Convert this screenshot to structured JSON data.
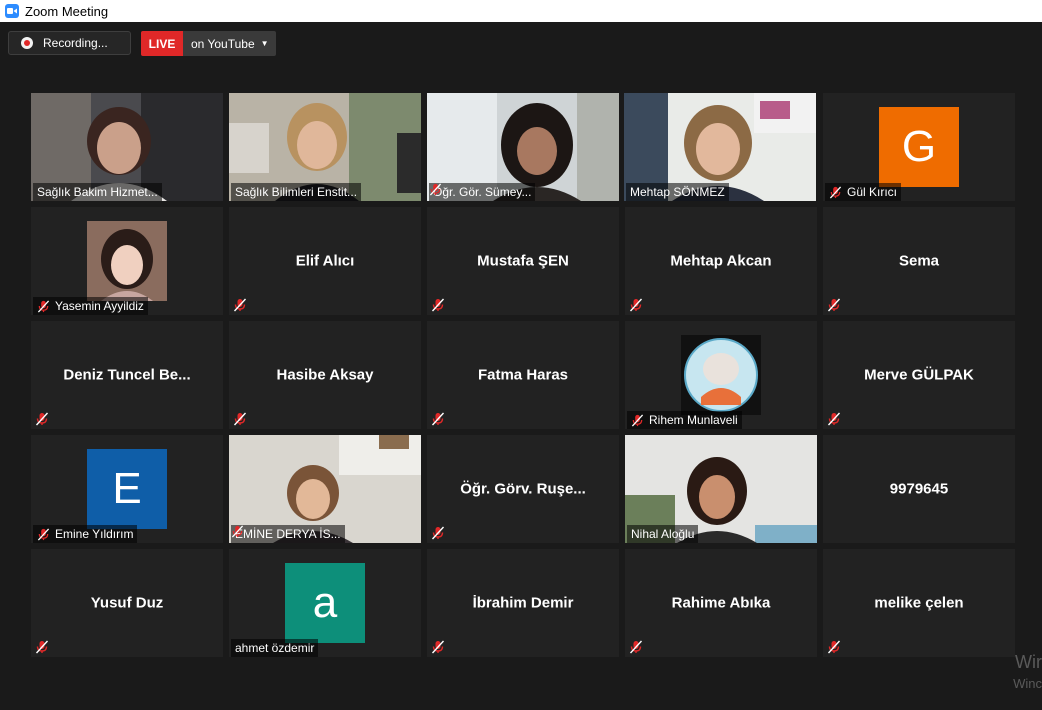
{
  "window": {
    "title": "Zoom Meeting"
  },
  "toolbar": {
    "recording_label": "Recording...",
    "live_badge": "LIVE",
    "live_target": "on YouTube"
  },
  "colors": {
    "active_speaker_border": "#dde64a",
    "live_red": "#e02828",
    "avatar_orange": "#ef6c00",
    "avatar_blue": "#0f5ea8",
    "avatar_teal": "#0d8f7a"
  },
  "participants": [
    {
      "name": "Sağlık Bakim Hizmet...",
      "video": true,
      "muted": false
    },
    {
      "name": "Sağlık Bilimleri Enstit...",
      "video": true,
      "muted": false
    },
    {
      "name": "Öğr. Gör. Sümey...",
      "video": true,
      "muted": true
    },
    {
      "name": "Mehtap SÖNMEZ",
      "video": true,
      "muted": false,
      "active_speaker": true
    },
    {
      "name": "Gül Kırıcı",
      "avatar_letter": "G",
      "muted": true
    },
    {
      "name": "Yasemin Ayyildiz",
      "avatar_photo": true,
      "muted": true
    },
    {
      "name": "Elif Alıcı",
      "muted": true
    },
    {
      "name": "Mustafa ŞEN",
      "muted": true
    },
    {
      "name": "Mehtap Akcan",
      "muted": true
    },
    {
      "name": "Sema",
      "muted": true
    },
    {
      "name": "Deniz Tuncel Be...",
      "muted": true
    },
    {
      "name": "Hasibe Aksay",
      "muted": true
    },
    {
      "name": "Fatma Haras",
      "muted": true
    },
    {
      "name": "Rihem Munlaveli",
      "avatar_photo": true,
      "muted": true
    },
    {
      "name": "Merve GÜLPAK",
      "muted": true
    },
    {
      "name": "Emine Yıldırım",
      "avatar_letter": "E",
      "muted": true
    },
    {
      "name": "EMİNE DERYA İS...",
      "video": true,
      "muted": true
    },
    {
      "name": "Öğr. Görv. Ruşe...",
      "muted": true
    },
    {
      "name": "Nihal Aloğlu",
      "video": true,
      "muted": false
    },
    {
      "name": "9979645",
      "muted": false
    },
    {
      "name": "Yusuf Duz",
      "muted": true
    },
    {
      "name": "ahmet özdemir",
      "avatar_letter": "a",
      "muted": false
    },
    {
      "name": "İbrahim Demir",
      "muted": true
    },
    {
      "name": "Rahime Abıka",
      "muted": true
    },
    {
      "name": "melike çelen",
      "muted": true
    }
  ],
  "watermark": {
    "line1": "Wir",
    "line2": "Winc"
  }
}
